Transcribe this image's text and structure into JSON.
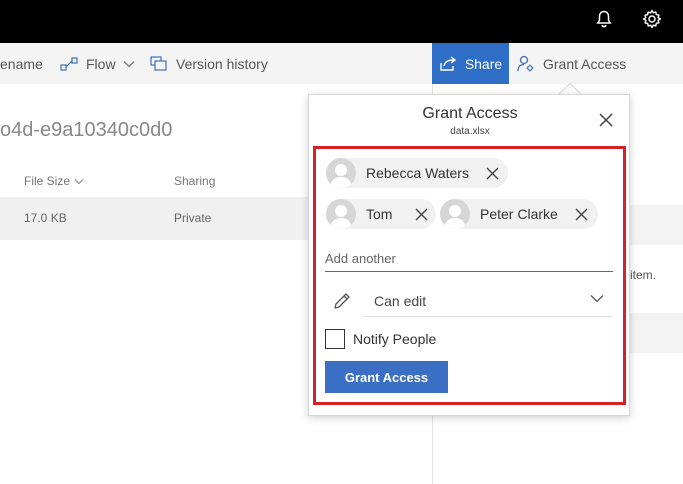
{
  "commandbar": {
    "rename_label": "ename",
    "flow_label": "Flow",
    "version_history_label": "Version history",
    "share_label": "Share",
    "grant_access_label": "Grant Access"
  },
  "main": {
    "title_fragment": "o4d-e9a10340c0d0",
    "columns": {
      "file_size": "File Size",
      "sharing": "Sharing"
    },
    "row": {
      "file_size": "17.0 KB",
      "sharing": "Private"
    }
  },
  "right_panel": {
    "text_fragment": "item."
  },
  "dialog": {
    "title": "Grant Access",
    "filename": "data.xlsx",
    "people": [
      {
        "name": "Rebecca Waters"
      },
      {
        "name": "Tom"
      },
      {
        "name": "Peter Clarke"
      }
    ],
    "add_placeholder": "Add another",
    "permission_value": "Can edit",
    "notify_label": "Notify People",
    "notify_checked": false,
    "submit_label": "Grant Access"
  },
  "colors": {
    "share_blue": "#2f6ec7",
    "button_blue": "#3a6fc4",
    "highlight_red": "#d8202a",
    "topbar": "#000000"
  },
  "icons": [
    "bell-icon",
    "gear-icon",
    "flow-icon",
    "version-history-icon",
    "share-icon",
    "grant-access-icon",
    "close-icon",
    "avatar-icon",
    "remove-icon",
    "pencil-icon",
    "chevron-down-icon"
  ]
}
